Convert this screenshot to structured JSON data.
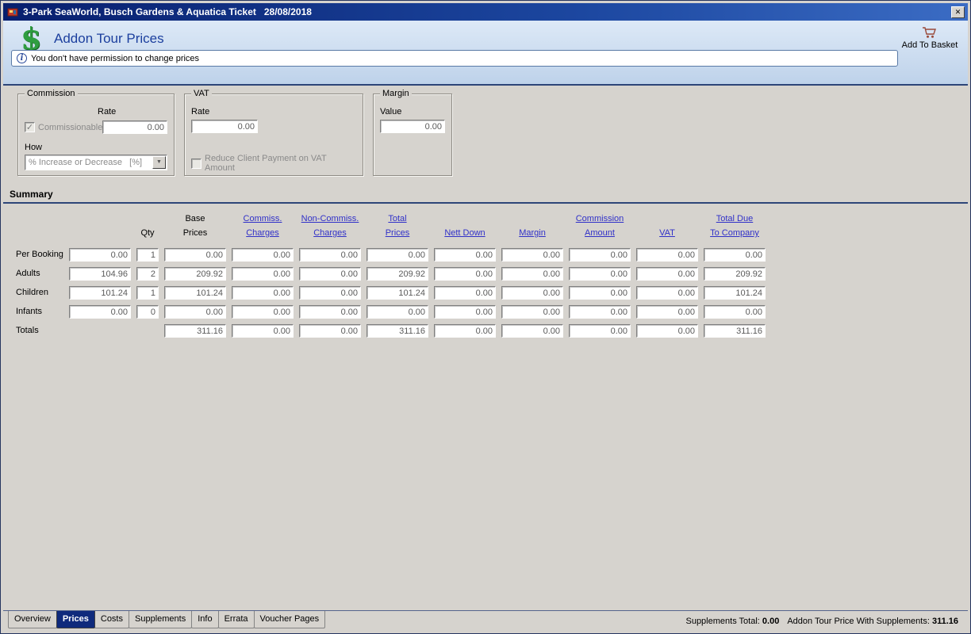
{
  "icons": {
    "dollar": "$",
    "info": "i",
    "dropdown_arrow": "▼",
    "close": "✕",
    "check": "✓"
  },
  "window": {
    "title": "3-Park SeaWorld, Busch Gardens & Aquatica Ticket   28/08/2018"
  },
  "header": {
    "title": "Addon Tour Prices",
    "info_message": "You don't have permission to change prices",
    "add_to_basket": "Add To Basket"
  },
  "commission_box": {
    "title": "Commission",
    "rate_label": "Rate",
    "commissionable_label": "Commissionable",
    "commissionable_checked": true,
    "rate_value": "0.00",
    "how_label": "How",
    "how_value": "% Increase or Decrease   [%]"
  },
  "vat_box": {
    "title": "VAT",
    "rate_label": "Rate",
    "rate_value": "0.00",
    "reduce_label": "Reduce Client Payment on VAT Amount",
    "reduce_checked": false
  },
  "margin_box": {
    "title": "Margin",
    "value_label": "Value",
    "value": "0.00"
  },
  "summary": {
    "title": "Summary",
    "columns": [
      {
        "line1": "",
        "line2": "",
        "link": false
      },
      {
        "line1": "",
        "line2": "",
        "link": false
      },
      {
        "line1": "",
        "line2": "Qty",
        "link": false
      },
      {
        "line1": "Base",
        "line2": "Prices",
        "link": false
      },
      {
        "line1": "Commiss.",
        "line2": "Charges",
        "link": true
      },
      {
        "line1": "Non-Commiss.",
        "line2": "Charges",
        "link": true
      },
      {
        "line1": "Total",
        "line2": "Prices",
        "link": true
      },
      {
        "line1": "",
        "line2": "Nett Down",
        "link": true
      },
      {
        "line1": "",
        "line2": "Margin",
        "link": true
      },
      {
        "line1": "Commission",
        "line2": "Amount",
        "link": true
      },
      {
        "line1": "",
        "line2": "VAT",
        "link": true
      },
      {
        "line1": "Total Due",
        "line2": "To Company",
        "link": true
      }
    ],
    "rows": [
      {
        "label": "Per Booking",
        "unit": "0.00",
        "qty": "1",
        "values": [
          "0.00",
          "0.00",
          "0.00",
          "0.00",
          "0.00",
          "0.00",
          "0.00",
          "0.00",
          "0.00"
        ]
      },
      {
        "label": "Adults",
        "unit": "104.96",
        "qty": "2",
        "values": [
          "209.92",
          "0.00",
          "0.00",
          "209.92",
          "0.00",
          "0.00",
          "0.00",
          "0.00",
          "209.92"
        ]
      },
      {
        "label": "Children",
        "unit": "101.24",
        "qty": "1",
        "values": [
          "101.24",
          "0.00",
          "0.00",
          "101.24",
          "0.00",
          "0.00",
          "0.00",
          "0.00",
          "101.24"
        ]
      },
      {
        "label": "Infants",
        "unit": "0.00",
        "qty": "0",
        "values": [
          "0.00",
          "0.00",
          "0.00",
          "0.00",
          "0.00",
          "0.00",
          "0.00",
          "0.00",
          "0.00"
        ]
      },
      {
        "label": "Totals",
        "unit": null,
        "qty": null,
        "values": [
          "311.16",
          "0.00",
          "0.00",
          "311.16",
          "0.00",
          "0.00",
          "0.00",
          "0.00",
          "311.16"
        ]
      }
    ]
  },
  "tabs": {
    "items": [
      "Overview",
      "Prices",
      "Costs",
      "Supplements",
      "Info",
      "Errata",
      "Voucher Pages"
    ],
    "active": "Prices"
  },
  "statusbar": {
    "supplements_total_label": "Supplements Total:",
    "supplements_total_value": "0.00",
    "price_with_supplements_label": "Addon Tour Price With Supplements:",
    "price_with_supplements_value": "311.16"
  }
}
